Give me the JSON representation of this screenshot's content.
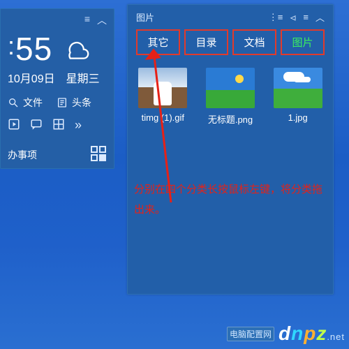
{
  "clock_panel": {
    "menu_glyph": "≡",
    "collapse_glyph": "︿",
    "time_prefix": ":",
    "time": "55",
    "date": "10月09日",
    "weekday": "星期三",
    "links": {
      "search_icon": "search",
      "files_label": "文件",
      "doc_icon": "doc",
      "headlines_label": "头条"
    },
    "iconbar_more": "»",
    "bottom_label": "办事项"
  },
  "panel": {
    "title": "图片",
    "head_icons": {
      "view": "⋮≡",
      "lock": "⏿",
      "menu": "≡",
      "collapse": "︿"
    },
    "tabs": [
      {
        "label": "其它"
      },
      {
        "label": "目录"
      },
      {
        "label": "文档"
      },
      {
        "label": "图片",
        "active": true
      }
    ],
    "files": [
      {
        "name": "timg (1).gif",
        "thumb": "portrait"
      },
      {
        "name": "无标题.png",
        "thumb": "landscape1"
      },
      {
        "name": "1.jpg",
        "thumb": "landscape2"
      }
    ]
  },
  "annotation": {
    "line1": "分别在四个分类长按鼠标左键，将分类拖",
    "line2": "出来。"
  },
  "watermark": {
    "brand_d": "d",
    "brand_n": "n",
    "brand_p": "p",
    "brand_z": "z",
    "sub": "电脑配置网",
    "domain": ".net"
  }
}
